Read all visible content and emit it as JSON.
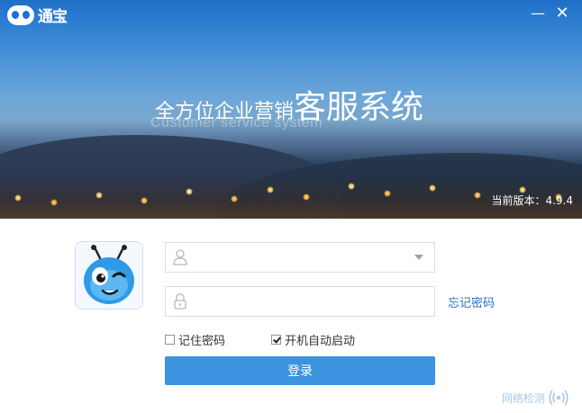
{
  "window": {
    "app_name": "通宝",
    "minimize_symbol": "—",
    "close_symbol": "✕"
  },
  "banner": {
    "headline_small": "全方位企业营销",
    "headline_big": "客服系统",
    "subline": "Customer service system",
    "version": "当前版本：4.9.4"
  },
  "login": {
    "username_value": "",
    "password_value": "",
    "forgot_password": "忘记密码",
    "remember_password_label": "记住密码",
    "remember_password_checked": false,
    "autostart_label": "开机自动启动",
    "autostart_checked": true,
    "login_button": "登录",
    "network_check": "网络检测"
  },
  "icons": {
    "user": "user-icon",
    "lock": "lock-icon",
    "dropdown": "chevron-down-icon",
    "network": "signal-icon",
    "avatar": "ant-mascot-avatar"
  },
  "colors": {
    "accent": "#3c93e0",
    "link": "#2d72c8",
    "banner_top": "#1f6fc7"
  }
}
